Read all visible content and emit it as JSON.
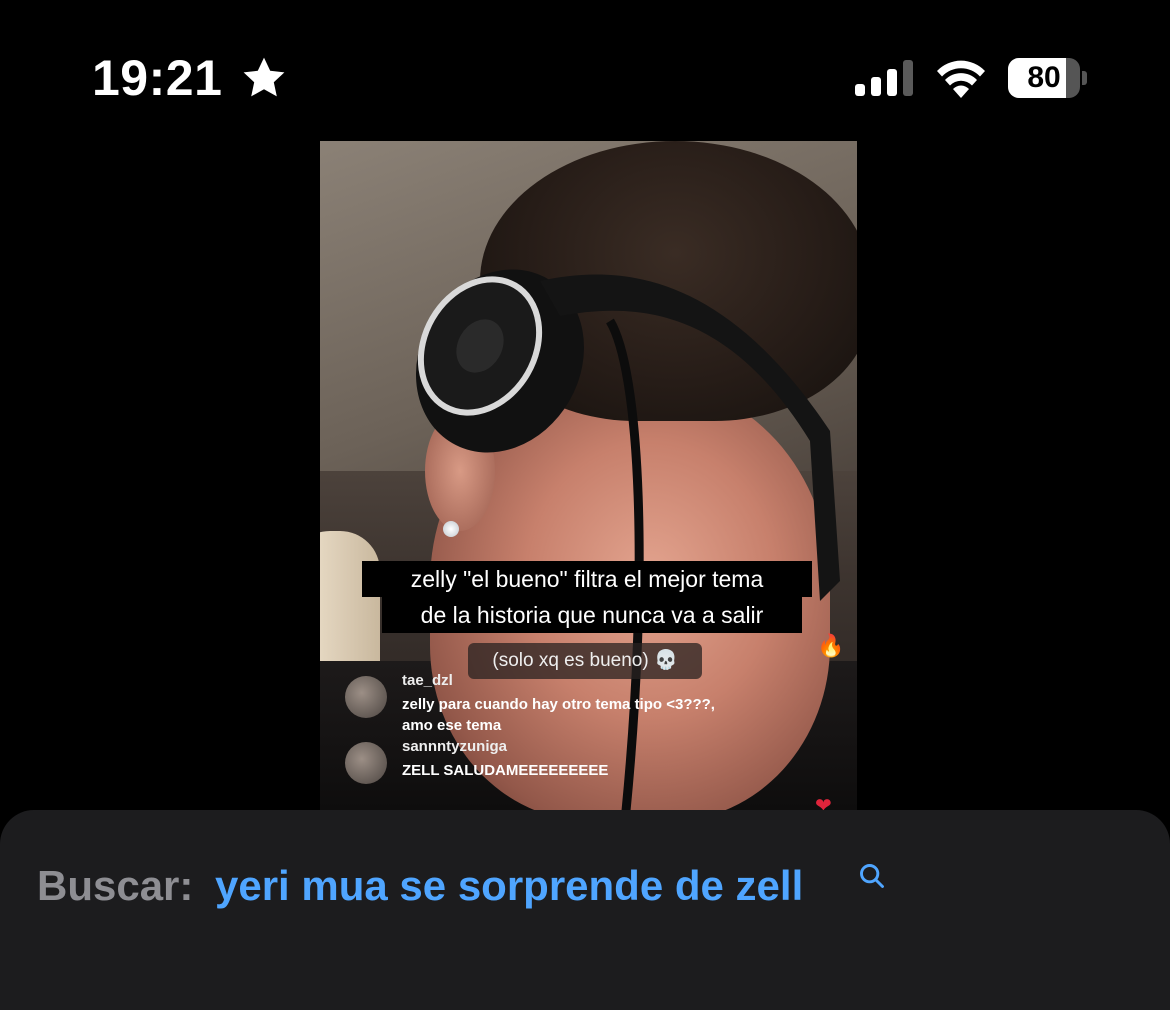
{
  "status_bar": {
    "time": "19:21",
    "battery_percent": "80",
    "battery_level": 0.8,
    "icons": [
      "star-icon",
      "signal-icon",
      "wifi-icon",
      "battery-icon"
    ]
  },
  "video": {
    "caption_line_1": "zelly \"el bueno\" filtra el mejor tema",
    "caption_line_2": "de la historia que nunca va a salir",
    "caption_sub": "(solo xq es bueno) 💀",
    "comments": [
      {
        "user": "tae_dzl",
        "message": "zelly para cuando hay otro tema tipo <3???, amo ese tema"
      },
      {
        "user": "sannntyzuniga",
        "message": "ZELL SALUDAMEEEEEEEEE"
      }
    ],
    "reactions": {
      "fire": "🔥",
      "heart": "❤"
    }
  },
  "search": {
    "label": "Buscar:",
    "query": "yeri mua se sorprende de zell"
  },
  "colors": {
    "accent": "#4fa5ff",
    "sheet_bg": "#1c1c1e",
    "label_gray": "#8e8e93"
  }
}
